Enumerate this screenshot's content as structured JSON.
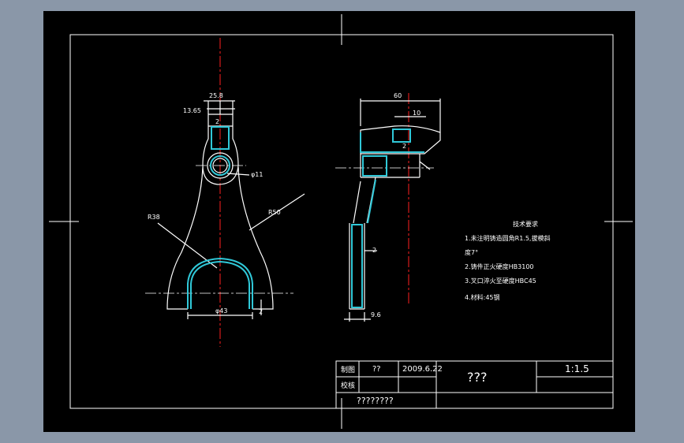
{
  "colors": {
    "background": "#8a97a8",
    "sheet": "#000000",
    "outline": "#ffffff",
    "centerline": "#ff2020",
    "section": "#30c8d8"
  },
  "dimensions": {
    "top_width": "25.8",
    "top_offset": "13.65",
    "slot": "2",
    "bore": "φ11",
    "radius_big": "R38",
    "radius_arm": "R50",
    "bottom_width": "φ43",
    "bottom_2": "2",
    "side_width": "60",
    "side_10": "10",
    "side_2a": "2",
    "side_2b": "2",
    "side_bottom": "9.6"
  },
  "tech": {
    "title": "技术要求",
    "line1": "1.未注明铸造圆角R1.5,拔模斜",
    "line1b": "度7°",
    "line2": "2.铸件正火硬度HB3100",
    "line3": "3.叉口淬火至硬度HBC45",
    "line4": "4.材料:45钢"
  },
  "titleblock": {
    "label_drawn": "制图",
    "label_checked": "校核",
    "drawn_by": "??",
    "date": "2009.6.22",
    "part_name": "???",
    "scale": "1:1.5",
    "school": "????????"
  }
}
